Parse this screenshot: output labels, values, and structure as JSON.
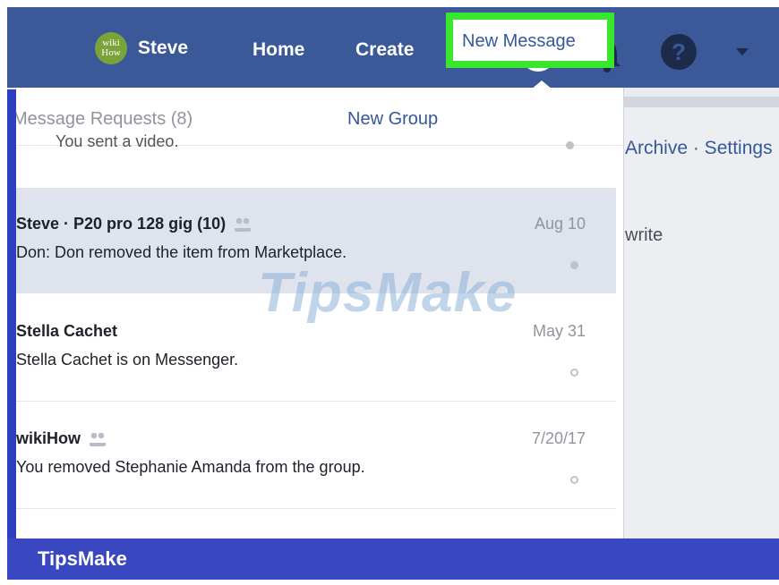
{
  "topbar": {
    "avatar_line1": "wiki",
    "avatar_line2": "How",
    "user_name": "Steve",
    "home": "Home",
    "create": "Create",
    "help": "?"
  },
  "messenger": {
    "message_requests": "Message Requests (8)",
    "new_group": "New Group",
    "new_message": "New Message",
    "highlight_color": "#39e62b",
    "cut_off_text": "You sent a video.",
    "threads": [
      {
        "name": "Steve · P20 pro 128 gig (10)",
        "group": true,
        "snippet": "Don: Don removed the item from Marketplace.",
        "date": "Aug 10",
        "unread": false
      },
      {
        "name": "Stella Cachet",
        "group": false,
        "snippet": "Stella Cachet is on Messenger.",
        "date": "May 31",
        "unread": true
      },
      {
        "name": "wikiHow",
        "group": true,
        "snippet": "You removed Stephanie Amanda from the group.",
        "date": "7/20/17",
        "unread": true
      }
    ]
  },
  "right_pane": {
    "links": "Archive · Settings",
    "write": "write"
  },
  "watermark": "TipsMake",
  "footer": {
    "brand": "TipsMake"
  },
  "colors": {
    "facebook_blue": "#3b5998",
    "footer_blue": "#3947c0",
    "link_blue": "#365899"
  }
}
